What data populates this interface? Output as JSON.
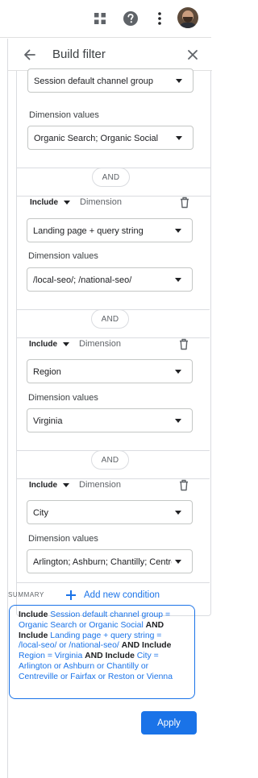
{
  "panel": {
    "title": "Build filter"
  },
  "conditions": {
    "first_dimension": "Session default channel group",
    "first_values_label": "Dimension values",
    "first_values": "Organic Search; Organic Social",
    "and_label": "AND",
    "items": [
      {
        "include": "Include",
        "dimension_label": "Dimension",
        "dimension": "Landing page + query string",
        "values_label": "Dimension values",
        "values": "/local-seo/; /national-seo/"
      },
      {
        "include": "Include",
        "dimension_label": "Dimension",
        "dimension": "Region",
        "values_label": "Dimension values",
        "values": "Virginia"
      },
      {
        "include": "Include",
        "dimension_label": "Dimension",
        "dimension": "City",
        "values_label": "Dimension values",
        "values": "Arlington; Ashburn; Chantilly; Centrev"
      }
    ],
    "add_label": "Add new condition"
  },
  "summary": {
    "label": "SUMMARY",
    "parts": [
      {
        "k": "Include"
      },
      {
        "v": "Session default channel group = Organic Search or Organic Social"
      },
      {
        "k": "AND Include"
      },
      {
        "v": "Landing page + query string = /local-seo/ or /national-seo/"
      },
      {
        "k": "AND Include"
      },
      {
        "v": "Region = Virginia"
      },
      {
        "k": "AND Include"
      },
      {
        "v": "City = Arlington or Ashburn or Chantilly or Centreville or Fairfax or Reston or Vienna"
      }
    ]
  },
  "footer": {
    "apply_label": "Apply"
  },
  "colors": {
    "accent": "#1a73e8",
    "border": "#dadce0"
  },
  "icons": [
    "apps-grid-icon",
    "help-icon",
    "more-vert-icon",
    "avatar",
    "back-arrow-icon",
    "close-icon",
    "delete-icon",
    "dropdown-caret-icon",
    "add-icon"
  ]
}
